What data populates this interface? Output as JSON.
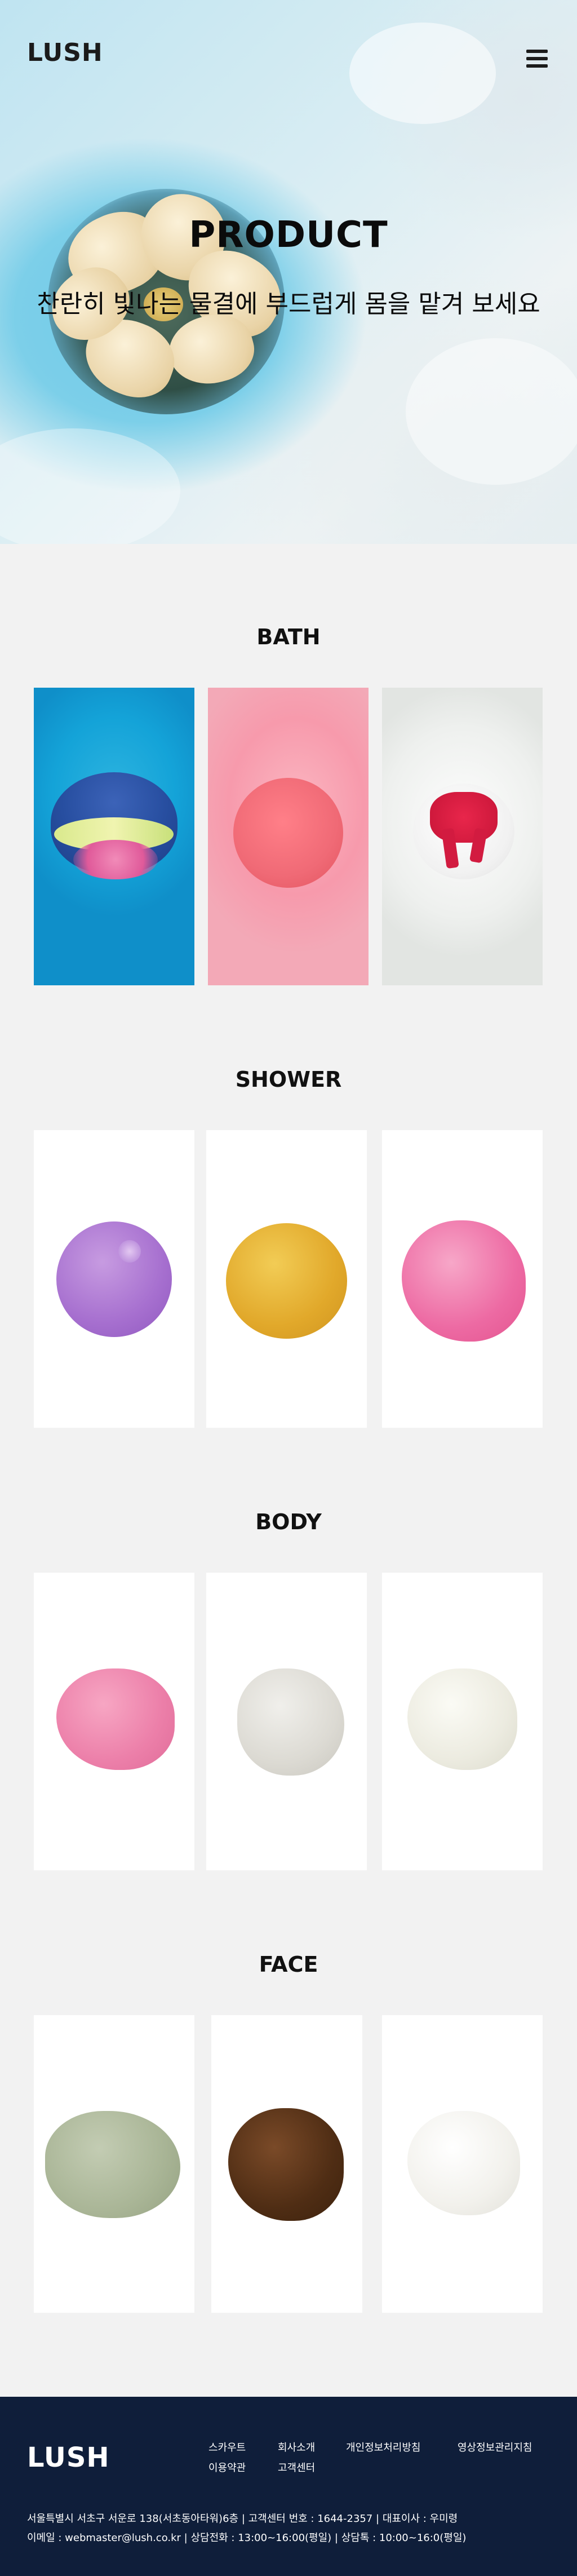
{
  "brand": {
    "logo": "LUSH"
  },
  "hero": {
    "title": "PRODUCT",
    "subtitle": "찬란히 빛나는 물결에 부드럽게 몸을 맡겨 보세요"
  },
  "sections": [
    {
      "title": "BATH"
    },
    {
      "title": "SHOWER"
    },
    {
      "title": "BODY"
    },
    {
      "title": "FACE"
    }
  ],
  "colors": {
    "footer_bg": "#0f1e3a",
    "page_bg": "#f2f2f2"
  },
  "footer": {
    "logo": "LUSH",
    "nav": [
      "스카우트",
      "회사소개",
      "개인정보처리방침",
      "영상정보관리지침",
      "이용약관",
      "고객센터"
    ],
    "info_line1": "서울특별시 서초구 서운로 138(서초동아타워)6층  |  고객센터 번호 : 1644-2357  |  대표이사 : 우미령",
    "info_line2": "이메일 : webmaster@lush.co.kr | 상담전화 : 13:00~16:00(평일)  |  상담톡 : 10:00~16:0(평일)"
  }
}
